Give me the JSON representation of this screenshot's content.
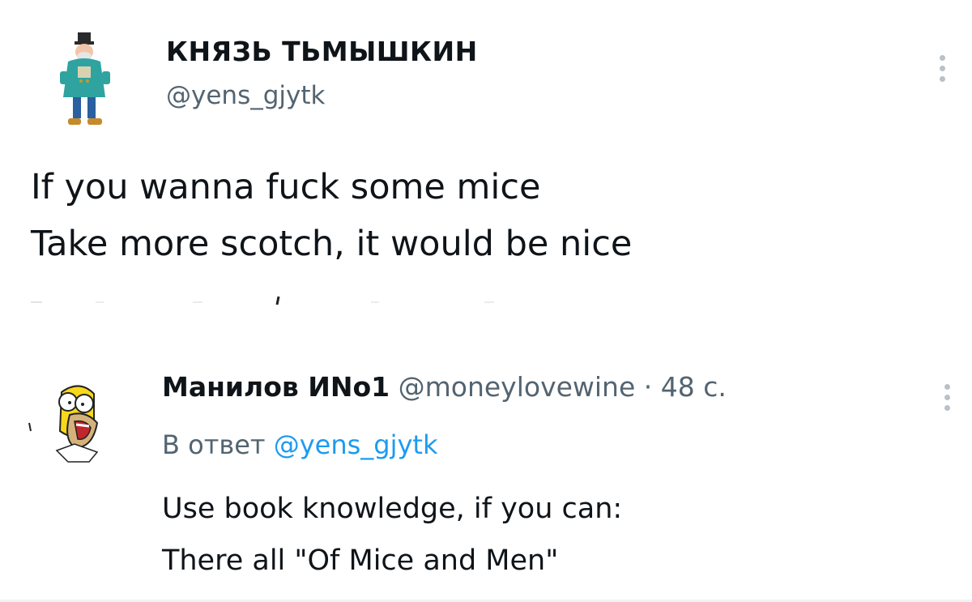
{
  "tweet": {
    "author_name": "КНЯЗЬ ТЬМЫШКИН",
    "handle": "@yens_gjytk",
    "lines": [
      "If you wanna fuck some mice",
      "Take more scotch, it would be nice"
    ],
    "more_icon": "more-vertical-icon"
  },
  "reply": {
    "author_name": "Манилов ИNo1",
    "handle": "@moneylovewine",
    "separator": "·",
    "time": "48 с.",
    "reply_to_label": "В ответ",
    "reply_to_handle": "@yens_gjytk",
    "lines": [
      "Use book knowledge, if you can:",
      "There all \"Of Mice and Men\""
    ],
    "more_icon": "more-vertical-icon"
  },
  "colors": {
    "text": "#0f1419",
    "muted": "#536471",
    "link": "#1d9bf0",
    "background": "#ffffff"
  }
}
